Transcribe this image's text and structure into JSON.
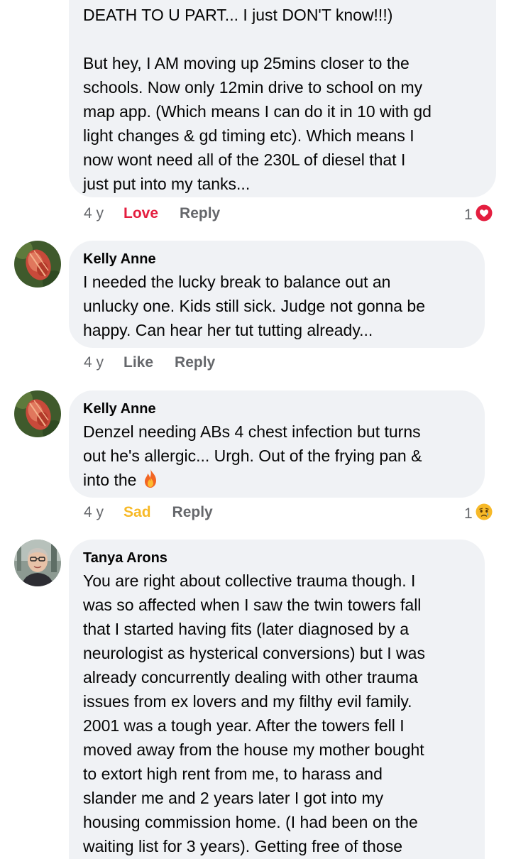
{
  "comments": [
    {
      "lines": [
        "DEATH TO U PART... I just DON'T know!!!)",
        "",
        "But hey, I AM moving up 25mins closer to the",
        "schools. Now only 12min drive to school on my",
        "map app. (Which means I can do it in 10 with gd",
        "light changes & gd timing etc). Which means I",
        "now wont need all of the 230L of diesel that I",
        "just put into my tanks..."
      ],
      "age": "4 y",
      "reaction_label": "Love",
      "reply_label": "Reply",
      "reaction_count": "1",
      "reaction_icon": "love-react-icon",
      "reaction_color": "#e41e3f"
    },
    {
      "author": "Kelly Anne",
      "lines": [
        "I needed the lucky break to balance out an",
        "unlucky one. Kids still sick. Judge not gonna be",
        "happy. Can hear her tut tutting already..."
      ],
      "age": "4 y",
      "reaction_label": "Like",
      "reply_label": "Reply"
    },
    {
      "author": "Kelly Anne",
      "lines": [
        "Denzel needing ABs 4 chest infection but turns",
        "out he's allergic... Urgh. Out of the frying pan &",
        "into the"
      ],
      "inline_emoji": "fire-emoji-icon",
      "age": "4 y",
      "reaction_label": "Sad",
      "reply_label": "Reply",
      "reaction_count": "1",
      "reaction_icon": "sad-react-icon",
      "reaction_color": "#f7b928"
    },
    {
      "author": "Tanya Arons",
      "lines": [
        "You are right about collective trauma though.  I",
        "was so affected when I saw the twin towers fall",
        "that I started having fits (later diagnosed by a",
        "neurologist as hysterical conversions) but I was",
        "already concurrently dealing with other trauma",
        "issues from ex lovers and my filthy evil family.",
        "2001 was a tough year. After the towers fell I",
        "moved away from the house my mother bought",
        "to extort high rent from me, to harass and",
        "slander me and 2 years later I got into my",
        "housing commission home. (I had been on the",
        "waiting list for 3 years). Getting free of those"
      ]
    }
  ],
  "colors": {
    "bubble": "#f0f2f5",
    "meta_text": "#65676b",
    "love": "#e41e3f",
    "sad": "#f7b928"
  }
}
